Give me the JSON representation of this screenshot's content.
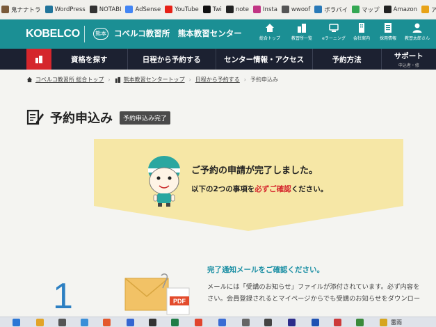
{
  "bookmarks": [
    {
      "label": "鬼ナナトラ",
      "icon": "bookmark-icon",
      "color": "#7a5a3a"
    },
    {
      "label": "WordPress",
      "icon": "wordpress-icon",
      "color": "#21759b"
    },
    {
      "label": "NOTABI",
      "icon": "notabi-icon",
      "color": "#333333"
    },
    {
      "label": "AdSense",
      "icon": "adsense-icon",
      "color": "#4285f4"
    },
    {
      "label": "YouTube",
      "icon": "youtube-icon",
      "color": "#e62117"
    },
    {
      "label": "Twi",
      "icon": "twitter-icon",
      "color": "#111111"
    },
    {
      "label": "note",
      "icon": "note-icon",
      "color": "#222222"
    },
    {
      "label": "Insta",
      "icon": "instagram-icon",
      "color": "#c13584"
    },
    {
      "label": "wwoof",
      "icon": "wwoof-icon",
      "color": "#555555"
    },
    {
      "label": "ボラバイ",
      "icon": "borabai-icon",
      "color": "#2a7ab8"
    },
    {
      "label": "マップ",
      "icon": "map-icon",
      "color": "#34a853"
    },
    {
      "label": "Amazon",
      "icon": "amazon-icon",
      "color": "#222222"
    },
    {
      "label": "アナジ",
      "icon": "anaji-icon",
      "color": "#e8a317"
    }
  ],
  "header": {
    "logo": "KOBELCO",
    "badge": "熊本",
    "center_name": "コベルコ教習所　熊本教習センター",
    "nav": [
      {
        "label": "総合トップ",
        "icon": "home-icon"
      },
      {
        "label": "教習所一覧",
        "icon": "buildings-icon"
      },
      {
        "label": "eラーニング",
        "icon": "elearning-icon"
      },
      {
        "label": "会社案内",
        "icon": "company-icon"
      },
      {
        "label": "採用情報",
        "icon": "recruit-icon"
      },
      {
        "label": "教習太郎さん",
        "icon": "user-icon"
      }
    ]
  },
  "main_nav": {
    "items": [
      "資格を探す",
      "日程から予約する",
      "センター情報・アクセス",
      "予約方法",
      "サポート"
    ],
    "support_sub": "申込者・修"
  },
  "breadcrumb": [
    "コベルコ教習所 総合トップ",
    "熊本教習センタートップ",
    "日程から予約する",
    "予約申込み"
  ],
  "page": {
    "title": "予約申込み",
    "status": "予約申込み完了"
  },
  "banner": {
    "line1": "ご予約の申請が完了しました。",
    "line2_pre": "以下の2つの事項を",
    "line2_em": "必ずご確認",
    "line2_post": "ください。"
  },
  "step": {
    "number": "1",
    "title": "完了通知メールをご確認ください。",
    "text1": "メールには「受講のお知らせ」ファイルが添付されています。必ず内容を",
    "text2": "さい。会員登録されるとマイページからでも受講のお知らせをダウンロー",
    "pdf_label": "PDF"
  },
  "taskbar": {
    "weather": "雷雨"
  },
  "colors": {
    "header_teal": "#1b8f94",
    "nav_dark": "#1c2131",
    "accent_red": "#d5262c",
    "banner_yellow": "#f6e7a6",
    "step_blue": "#2c7fc2"
  }
}
